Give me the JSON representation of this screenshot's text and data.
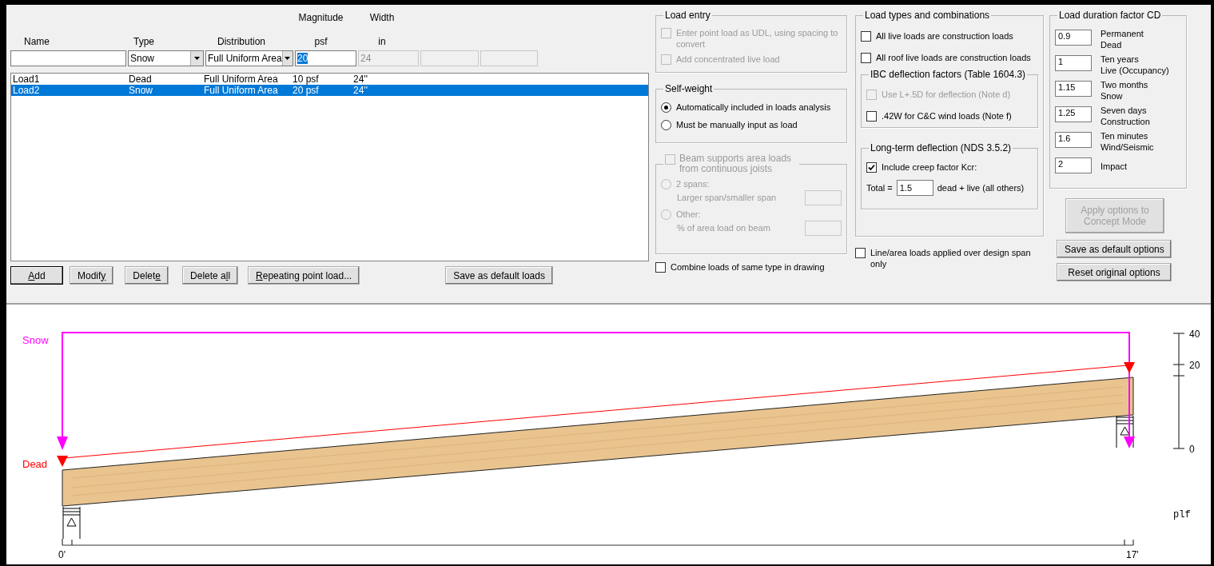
{
  "load_form": {
    "headers": [
      {
        "bottom": "Name"
      },
      {
        "bottom": "Type"
      },
      {
        "bottom": "Distribution"
      },
      {
        "top": "Magnitude",
        "bottom": "psf"
      },
      {
        "top": "Width",
        "bottom": "in"
      }
    ],
    "type": {
      "value": "Snow"
    },
    "distribution": {
      "value": "Full Uniform Area"
    },
    "magnitude": {
      "value": "20",
      "text_selected": true
    },
    "width": {
      "value": "24",
      "disabled": true
    },
    "extra_fields": [
      {
        "disabled": true
      },
      {
        "disabled": true
      }
    ],
    "rows": [
      {
        "name": "Load1",
        "type": "Dead",
        "distribution": "Full Uniform Area",
        "magnitude": "10 psf",
        "width": "24''",
        "selected": false
      },
      {
        "name": "Load2",
        "type": "Snow",
        "distribution": "Full Uniform Area",
        "magnitude": "20 psf",
        "width": "24''",
        "selected": true
      }
    ],
    "buttons": [
      {
        "key": "A",
        "after": "dd",
        "default": true
      },
      {
        "before": "Modif",
        "key": "y",
        "default": false
      },
      {
        "before": "Delet",
        "key": "e",
        "default": false
      },
      {
        "before": "Delete a",
        "key": "l",
        "after": "l",
        "default": false
      },
      {
        "key": "R",
        "after": "epeating point load...",
        "default": false
      },
      {
        "label": "Save as default loads",
        "kind": "right",
        "default": false
      }
    ]
  },
  "load_entry": {
    "title": "Load entry",
    "options": [
      {
        "label": "Enter point load as UDL, using spacing to convert",
        "checked": false,
        "disabled": true
      },
      {
        "label": "Add concentrated live load",
        "checked": false,
        "disabled": true
      }
    ]
  },
  "self_weight": {
    "title": "Self-weight",
    "options": [
      {
        "label": "Automatically included in loads analysis",
        "selected": true
      },
      {
        "label": "Must be manually input as load",
        "selected": false
      }
    ]
  },
  "area_loads": {
    "title": "Beam supports area loads from continuous joists",
    "checked": false,
    "disabled": true,
    "options": [
      {
        "label": "2 spans:",
        "sublabel": "Larger span/smaller span",
        "selected": false
      },
      {
        "label": "Other:",
        "sublabel": "% of area load on beam",
        "selected": false
      }
    ]
  },
  "combine": {
    "label": "Combine loads of same type in drawing",
    "checked": false
  },
  "load_types": {
    "title": "Load types and combinations",
    "options": [
      {
        "label": "All live loads are construction loads",
        "checked": false
      },
      {
        "label": "All roof live loads are construction loads",
        "checked": false
      }
    ],
    "ibc": {
      "title": "IBC deflection factors (Table 1604.3)",
      "options": [
        {
          "label": "Use L+.5D for deflection (Note d)",
          "checked": false,
          "disabled": true
        },
        {
          "label": ".42W for C&C wind loads (Note f)",
          "checked": false,
          "disabled": false
        }
      ]
    },
    "long_term": {
      "title": "Long-term deflection (NDS 3.5.2)",
      "creep": {
        "label": "Include creep factor Kcr:",
        "checked": true
      },
      "total_label": "Total =",
      "total_value": "1.5",
      "total_suffix": "dead + live (all others)"
    }
  },
  "line_area": {
    "label": "Line/area loads applied over design span only",
    "checked": false
  },
  "duration": {
    "title": "Load duration factor CD",
    "rows": [
      {
        "value": "0.9",
        "line1": "Permanent",
        "line2": "Dead"
      },
      {
        "value": "1",
        "line1": "Ten years",
        "line2": "Live (Occupancy)"
      },
      {
        "value": "1.15",
        "line1": "Two months",
        "line2": "Snow"
      },
      {
        "value": "1.25",
        "line1": "Seven days",
        "line2": "Construction"
      },
      {
        "value": "1.6",
        "line1": "Ten minutes",
        "line2": "Wind/Seismic"
      },
      {
        "value": "2",
        "line1": "Impact"
      }
    ]
  },
  "option_buttons": [
    {
      "label": "Apply options to Concept Mode",
      "disabled": true
    },
    {
      "label": "Save as default options",
      "disabled": false
    },
    {
      "label": "Reset original options",
      "disabled": false
    }
  ],
  "diagram": {
    "loads": [
      {
        "label": "Snow",
        "color": "#ff00ff"
      },
      {
        "label": "Dead",
        "color": "#ff0000"
      }
    ],
    "scale_labels": [
      "40",
      "20",
      "0"
    ],
    "unit": "plf",
    "span_start": "0'",
    "span_end": "17'"
  }
}
